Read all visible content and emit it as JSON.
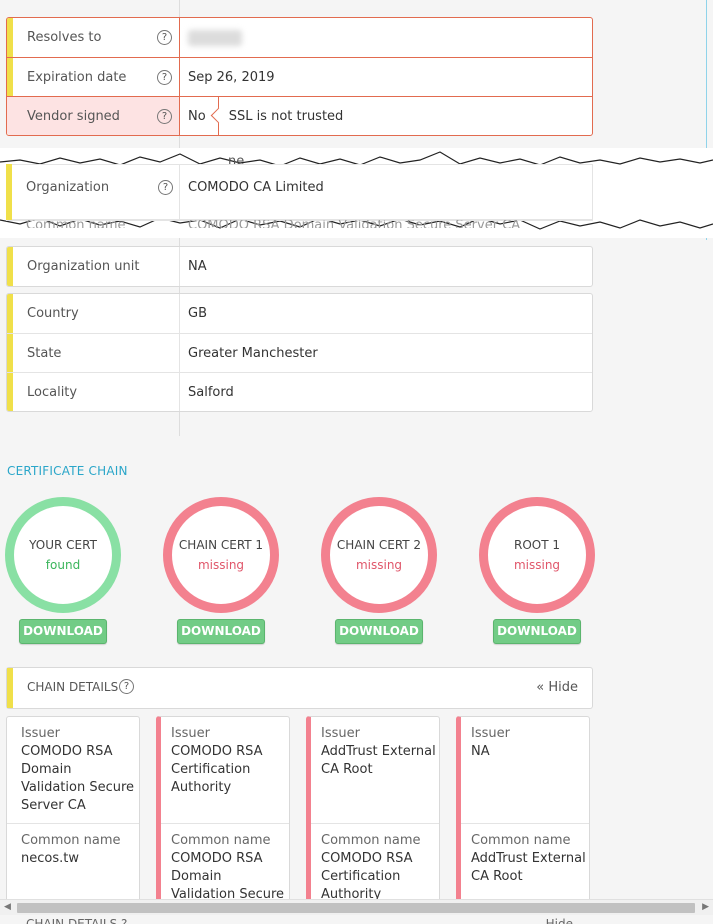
{
  "top_card": {
    "rows": [
      {
        "label": "Resolves to",
        "value": ""
      },
      {
        "label": "Expiration date",
        "value": "Sep 26, 2019"
      },
      {
        "label": "Vendor signed",
        "value": "No",
        "note": "SSL is not trusted"
      }
    ]
  },
  "torn": {
    "peek_top": "ne",
    "org_label": "Organization",
    "org_value": "COMODO CA Limited",
    "peek_bottom_label": "Common name",
    "peek_bottom_value": "COMODO RSA Domain Validation Secure Server CA"
  },
  "org_unit": {
    "label": "Organization unit",
    "value": "NA"
  },
  "location_card": {
    "rows": [
      {
        "label": "Country",
        "value": "GB"
      },
      {
        "label": "State",
        "value": "Greater Manchester"
      },
      {
        "label": "Locality",
        "value": "Salford"
      }
    ]
  },
  "chain": {
    "title": "CERTIFICATE CHAIN",
    "certs": [
      {
        "name": "YOUR CERT",
        "status": "found"
      },
      {
        "name": "CHAIN CERT 1",
        "status": "missing"
      },
      {
        "name": "CHAIN CERT 2",
        "status": "missing"
      },
      {
        "name": "ROOT 1",
        "status": "missing"
      }
    ],
    "download_label": "DOWNLOAD"
  },
  "chain_details": {
    "title": "CHAIN DETAILS",
    "help": "?",
    "hide_label": "« Hide",
    "cards": [
      {
        "issuer_label": "Issuer",
        "issuer": "COMODO RSA Domain Validation Secure Server CA",
        "cn_label": "Common name",
        "cn": "necos.tw"
      },
      {
        "issuer_label": "Issuer",
        "issuer": "COMODO RSA Certification Authority",
        "cn_label": "Common name",
        "cn": "COMODO RSA Domain Validation Secure"
      },
      {
        "issuer_label": "Issuer",
        "issuer": "AddTrust External CA Root",
        "cn_label": "Common name",
        "cn": "COMODO RSA Certification Authority"
      },
      {
        "issuer_label": "Issuer",
        "issuer": "NA",
        "cn_label": "Common name",
        "cn": "AddTrust External CA Root"
      }
    ]
  },
  "bottom_peek": {
    "left": "CHAIN DETAILS ?",
    "right": "Hide"
  },
  "colors": {
    "accent": "#2aa6c9",
    "found": "#89e0a4",
    "missing": "#f3818f",
    "bar": "#f0e04a",
    "error": "#e26b4f"
  }
}
